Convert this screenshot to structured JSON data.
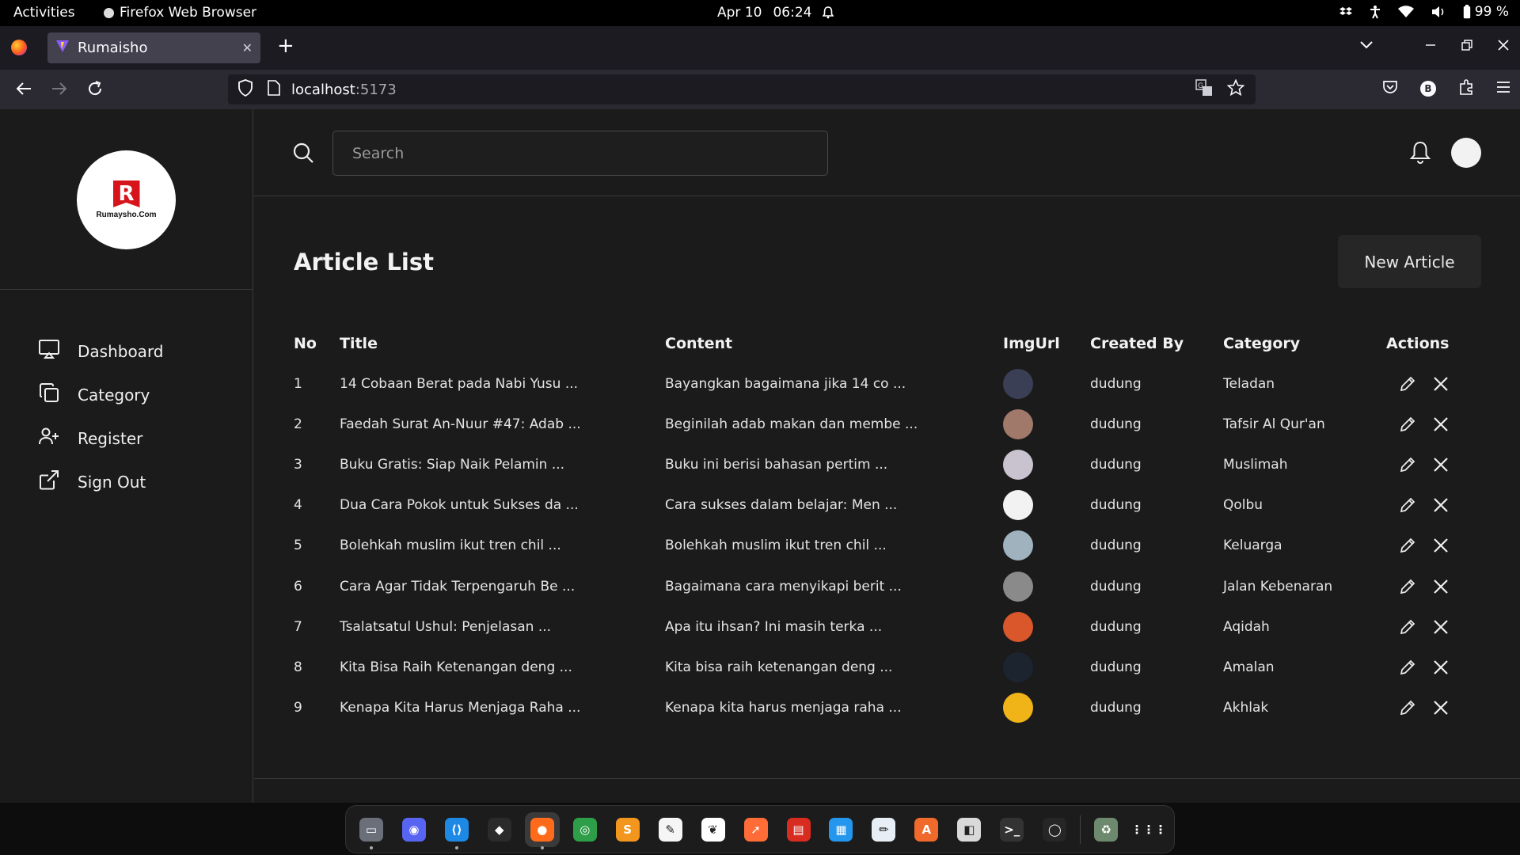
{
  "system": {
    "activities": "Activities",
    "app_name": "Firefox Web Browser",
    "date": "Apr 10",
    "time": "06:24",
    "battery": "99 %"
  },
  "browser": {
    "tab_title": "Rumaisho",
    "url_host": "localhost",
    "url_port": ":5173",
    "profile_badge": "B"
  },
  "app": {
    "logo_mark": "R",
    "logo_text": "Rumaysho.Com",
    "menu": [
      {
        "label": "Dashboard",
        "icon": "monitor-icon"
      },
      {
        "label": "Category",
        "icon": "copy-icon"
      },
      {
        "label": "Register",
        "icon": "user-plus-icon"
      },
      {
        "label": "Sign Out",
        "icon": "external-link-icon"
      }
    ],
    "search_placeholder": "Search",
    "page_title": "Article List",
    "new_article_label": "New Article",
    "columns": [
      "No",
      "Title",
      "Content",
      "ImgUrl",
      "Created By",
      "Category",
      "Actions"
    ],
    "rows": [
      {
        "no": "1",
        "title": "14 Cobaan Berat pada Nabi Yusu ...",
        "content": "Bayangkan bagaimana jika 14 co ...",
        "created_by": "dudung",
        "category": "Teladan",
        "thumb_color": "#3b3f55"
      },
      {
        "no": "2",
        "title": "Faedah Surat An-Nuur #47: Adab ...",
        "content": "Beginilah adab makan dan membe ...",
        "created_by": "dudung",
        "category": "Tafsir Al Qur'an",
        "thumb_color": "#a0796a"
      },
      {
        "no": "3",
        "title": "Buku Gratis: Siap Naik Pelamin ...",
        "content": "Buku ini berisi bahasan pertim ...",
        "created_by": "dudung",
        "category": "Muslimah",
        "thumb_color": "#c9c3cf"
      },
      {
        "no": "4",
        "title": "Dua Cara Pokok untuk Sukses da ...",
        "content": "Cara sukses dalam belajar: Men ...",
        "created_by": "dudung",
        "category": "Qolbu",
        "thumb_color": "#f2f2f2"
      },
      {
        "no": "5",
        "title": "Bolehkah muslim ikut tren chil ...",
        "content": "Bolehkah muslim ikut tren chil ...",
        "created_by": "dudung",
        "category": "Keluarga",
        "thumb_color": "#9fb2bd"
      },
      {
        "no": "6",
        "title": "Cara Agar Tidak Terpengaruh Be ...",
        "content": "Bagaimana cara menyikapi berit ...",
        "created_by": "dudung",
        "category": "Jalan Kebenaran",
        "thumb_color": "#8a8a8a"
      },
      {
        "no": "7",
        "title": "Tsalatsatul Ushul: Penjelasan ...",
        "content": "Apa itu ihsan? Ini masih terka ...",
        "created_by": "dudung",
        "category": "Aqidah",
        "thumb_color": "#d9572b"
      },
      {
        "no": "8",
        "title": "Kita Bisa Raih Ketenangan deng ...",
        "content": "Kita bisa raih ketenangan deng ...",
        "created_by": "dudung",
        "category": "Amalan",
        "thumb_color": "#1c2430"
      },
      {
        "no": "9",
        "title": "Kenapa Kita Harus Menjaga Raha ...",
        "content": "Kenapa kita harus menjaga raha ...",
        "created_by": "dudung",
        "category": "Akhlak",
        "thumb_color": "#f0b318"
      }
    ]
  },
  "dock": {
    "apps": [
      {
        "name": "files-icon",
        "color": "#6b6f7a",
        "glyph": "▭"
      },
      {
        "name": "discord-icon",
        "color": "#5865f2",
        "glyph": "◉"
      },
      {
        "name": "vscode-icon",
        "color": "#1e88e5",
        "glyph": "⟨⟩"
      },
      {
        "name": "figma-icon",
        "color": "#2b2b2b",
        "glyph": "◆"
      },
      {
        "name": "firefox-icon",
        "color": "#ff6b1a",
        "glyph": "●"
      },
      {
        "name": "chrome-icon",
        "color": "#2e9e48",
        "glyph": "◎"
      },
      {
        "name": "sublime-icon",
        "color": "#f2961e",
        "glyph": "S"
      },
      {
        "name": "inkscape-icon",
        "color": "#f5f5f5",
        "glyph": "✎"
      },
      {
        "name": "mongodb-icon",
        "color": "#ffffff",
        "glyph": "❦"
      },
      {
        "name": "postman-icon",
        "color": "#ff6c37",
        "glyph": "➚"
      },
      {
        "name": "redis-icon",
        "color": "#d82c20",
        "glyph": "▤"
      },
      {
        "name": "docker-icon",
        "color": "#2496ed",
        "glyph": "▦"
      },
      {
        "name": "text-editor-icon",
        "color": "#e8eef6",
        "glyph": "✏"
      },
      {
        "name": "software-center-icon",
        "color": "#ef6a2b",
        "glyph": "A"
      },
      {
        "name": "dbeaver-icon",
        "color": "#d9d9d9",
        "glyph": "◧"
      },
      {
        "name": "terminal-icon",
        "color": "#333333",
        "glyph": ">_"
      },
      {
        "name": "obs-icon",
        "color": "#262626",
        "glyph": "◯"
      },
      {
        "name": "trash-icon",
        "color": "#6e8a6e",
        "glyph": "♻"
      },
      {
        "name": "show-apps-icon",
        "color": "transparent",
        "glyph": "⋮⋮⋮"
      }
    ]
  }
}
